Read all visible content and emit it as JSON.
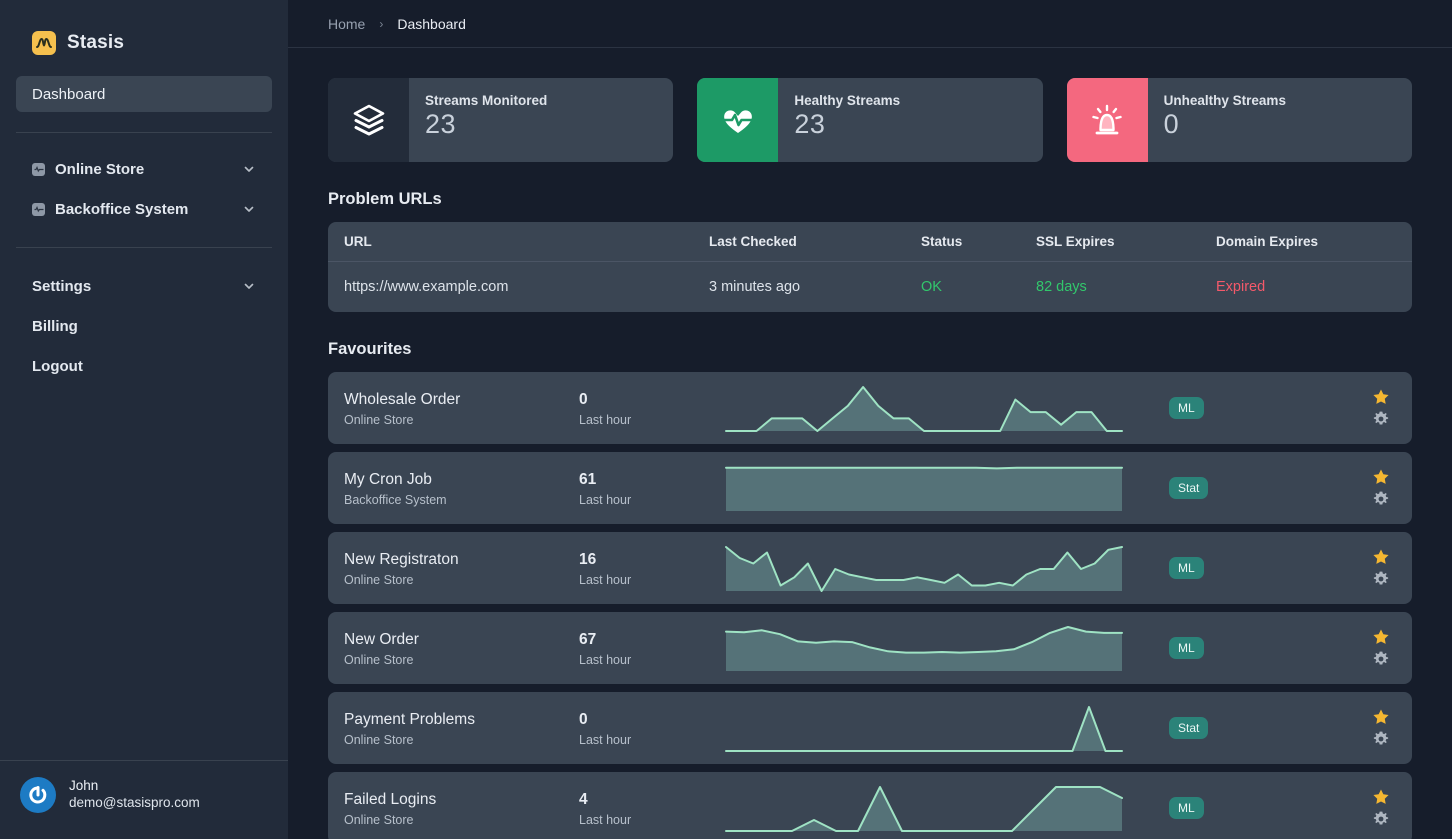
{
  "brand": {
    "name": "Stasis",
    "logo_icon": "wave-peak-logo-icon"
  },
  "sidebar": {
    "primary": [
      {
        "label": "Dashboard",
        "active": true
      }
    ],
    "groups": [
      {
        "label": "Online Store",
        "icon": "activity-square-icon",
        "chevron": "chevron-down-icon"
      },
      {
        "label": "Backoffice System",
        "icon": "activity-square-icon",
        "chevron": "chevron-down-icon"
      }
    ],
    "secondary": [
      {
        "label": "Settings",
        "chevron": "chevron-down-icon"
      },
      {
        "label": "Billing",
        "chevron": null
      },
      {
        "label": "Logout",
        "chevron": null
      }
    ],
    "user": {
      "name": "John",
      "email": "demo@stasispro.com",
      "avatar_icon": "power-avatar-icon"
    }
  },
  "topbar": {
    "breadcrumb": {
      "home": "Home",
      "separator": "›",
      "current": "Dashboard"
    }
  },
  "stats": [
    {
      "label": "Streams Monitored",
      "value": "23",
      "icon": "layers-icon",
      "tone": "dark"
    },
    {
      "label": "Healthy Streams",
      "value": "23",
      "icon": "heart-pulse-icon",
      "tone": "green"
    },
    {
      "label": "Unhealthy Streams",
      "value": "0",
      "icon": "alarm-light-icon",
      "tone": "red"
    }
  ],
  "problem_urls": {
    "title": "Problem URLs",
    "columns": [
      "URL",
      "Last Checked",
      "Status",
      "SSL Expires",
      "Domain Expires"
    ],
    "rows": [
      {
        "url": "https://www.example.com",
        "last_checked": "3 minutes ago",
        "status": "OK",
        "ssl_expires": "82 days",
        "domain_expires": "Expired"
      }
    ]
  },
  "favourites": {
    "title": "Favourites",
    "rows": [
      {
        "name": "Wholesale Order",
        "source": "Online Store",
        "value": "0",
        "period": "Last hour",
        "badge": "ML",
        "star_icon": "star-filled-icon",
        "gear_icon": "gear-icon"
      },
      {
        "name": "My Cron Job",
        "source": "Backoffice System",
        "value": "61",
        "period": "Last hour",
        "badge": "Stat",
        "star_icon": "star-filled-icon",
        "gear_icon": "gear-icon"
      },
      {
        "name": "New Registraton",
        "source": "Online Store",
        "value": "16",
        "period": "Last hour",
        "badge": "ML",
        "star_icon": "star-filled-icon",
        "gear_icon": "gear-icon"
      },
      {
        "name": "New Order",
        "source": "Online Store",
        "value": "67",
        "period": "Last hour",
        "badge": "ML",
        "star_icon": "star-filled-icon",
        "gear_icon": "gear-icon"
      },
      {
        "name": "Payment Problems",
        "source": "Online Store",
        "value": "0",
        "period": "Last hour",
        "badge": "Stat",
        "star_icon": "star-filled-icon",
        "gear_icon": "gear-icon"
      },
      {
        "name": "Failed Logins",
        "source": "Online Store",
        "value": "4",
        "period": "Last hour",
        "badge": "ML",
        "star_icon": "star-filled-icon",
        "gear_icon": "gear-icon"
      }
    ]
  },
  "chart_data": [
    {
      "type": "area",
      "title": "Wholesale Order",
      "series": [
        {
          "name": "Wholesale Order",
          "values": [
            0,
            0,
            0,
            2,
            2,
            2,
            0,
            2,
            4,
            7,
            4,
            2,
            2,
            0,
            0,
            0,
            0,
            0,
            0,
            5,
            3,
            3,
            1,
            3,
            3,
            0,
            0
          ]
        }
      ],
      "ylim": [
        0,
        7
      ],
      "grid": false,
      "legend": "none"
    },
    {
      "type": "area",
      "title": "My Cron Job",
      "series": [
        {
          "name": "My Cron Job",
          "values": [
            61,
            61,
            61,
            61,
            61,
            61,
            61,
            61,
            61,
            61,
            61,
            61,
            61,
            60,
            61,
            61,
            61,
            61,
            61,
            61
          ]
        }
      ],
      "ylim": [
        0,
        62
      ],
      "grid": false,
      "legend": "none"
    },
    {
      "type": "area",
      "title": "New Registraton",
      "series": [
        {
          "name": "New Registraton",
          "values": [
            16,
            12,
            10,
            14,
            2,
            5,
            10,
            0,
            8,
            6,
            5,
            4,
            4,
            4,
            5,
            4,
            3,
            6,
            2,
            2,
            3,
            2,
            6,
            8,
            8,
            14,
            8,
            10,
            15,
            16
          ]
        }
      ],
      "ylim": [
        0,
        16
      ],
      "grid": false,
      "legend": "none"
    },
    {
      "type": "area",
      "title": "New Order",
      "series": [
        {
          "name": "New Order",
          "values": [
            60,
            59,
            62,
            56,
            45,
            43,
            45,
            44,
            36,
            30,
            28,
            28,
            29,
            28,
            29,
            30,
            33,
            44,
            58,
            67,
            60,
            58,
            58
          ]
        }
      ],
      "ylim": [
        0,
        67
      ],
      "grid": false,
      "legend": "none"
    },
    {
      "type": "area",
      "title": "Payment Problems",
      "series": [
        {
          "name": "Payment Problems",
          "values": [
            0,
            0,
            0,
            0,
            0,
            0,
            0,
            0,
            0,
            0,
            0,
            0,
            0,
            0,
            0,
            0,
            0,
            0,
            0,
            0,
            0,
            0,
            8,
            0,
            0
          ]
        }
      ],
      "ylim": [
        0,
        8
      ],
      "grid": false,
      "legend": "none"
    },
    {
      "type": "area",
      "title": "Failed Logins",
      "series": [
        {
          "name": "Failed Logins",
          "values": [
            0,
            0,
            0,
            0,
            1,
            0,
            0,
            4,
            0,
            0,
            0,
            0,
            0,
            0,
            2,
            4,
            4,
            4,
            3
          ]
        }
      ],
      "ylim": [
        0,
        4
      ],
      "grid": false,
      "legend": "none"
    }
  ],
  "colors": {
    "accent_yellow": "#f5c04e",
    "green": "#1d9a66",
    "red": "#f4687f",
    "teal_badge": "#2b8379",
    "spark_line": "#9fe3c4",
    "spark_fill": "#5f8184",
    "status_ok": "#32c76c",
    "status_expired": "#f4596a"
  }
}
